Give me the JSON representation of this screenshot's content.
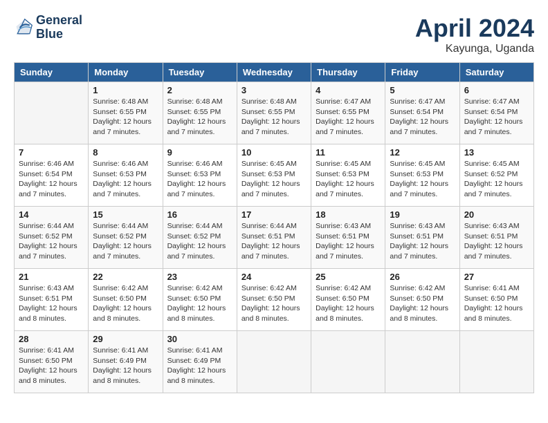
{
  "header": {
    "logo_line1": "General",
    "logo_line2": "Blue",
    "month": "April 2024",
    "location": "Kayunga, Uganda"
  },
  "weekdays": [
    "Sunday",
    "Monday",
    "Tuesday",
    "Wednesday",
    "Thursday",
    "Friday",
    "Saturday"
  ],
  "weeks": [
    [
      {
        "day": "",
        "info": ""
      },
      {
        "day": "1",
        "info": "Sunrise: 6:48 AM\nSunset: 6:55 PM\nDaylight: 12 hours\nand 7 minutes."
      },
      {
        "day": "2",
        "info": "Sunrise: 6:48 AM\nSunset: 6:55 PM\nDaylight: 12 hours\nand 7 minutes."
      },
      {
        "day": "3",
        "info": "Sunrise: 6:48 AM\nSunset: 6:55 PM\nDaylight: 12 hours\nand 7 minutes."
      },
      {
        "day": "4",
        "info": "Sunrise: 6:47 AM\nSunset: 6:55 PM\nDaylight: 12 hours\nand 7 minutes."
      },
      {
        "day": "5",
        "info": "Sunrise: 6:47 AM\nSunset: 6:54 PM\nDaylight: 12 hours\nand 7 minutes."
      },
      {
        "day": "6",
        "info": "Sunrise: 6:47 AM\nSunset: 6:54 PM\nDaylight: 12 hours\nand 7 minutes."
      }
    ],
    [
      {
        "day": "7",
        "info": "Sunrise: 6:46 AM\nSunset: 6:54 PM\nDaylight: 12 hours\nand 7 minutes."
      },
      {
        "day": "8",
        "info": "Sunrise: 6:46 AM\nSunset: 6:53 PM\nDaylight: 12 hours\nand 7 minutes."
      },
      {
        "day": "9",
        "info": "Sunrise: 6:46 AM\nSunset: 6:53 PM\nDaylight: 12 hours\nand 7 minutes."
      },
      {
        "day": "10",
        "info": "Sunrise: 6:45 AM\nSunset: 6:53 PM\nDaylight: 12 hours\nand 7 minutes."
      },
      {
        "day": "11",
        "info": "Sunrise: 6:45 AM\nSunset: 6:53 PM\nDaylight: 12 hours\nand 7 minutes."
      },
      {
        "day": "12",
        "info": "Sunrise: 6:45 AM\nSunset: 6:53 PM\nDaylight: 12 hours\nand 7 minutes."
      },
      {
        "day": "13",
        "info": "Sunrise: 6:45 AM\nSunset: 6:52 PM\nDaylight: 12 hours\nand 7 minutes."
      }
    ],
    [
      {
        "day": "14",
        "info": "Sunrise: 6:44 AM\nSunset: 6:52 PM\nDaylight: 12 hours\nand 7 minutes."
      },
      {
        "day": "15",
        "info": "Sunrise: 6:44 AM\nSunset: 6:52 PM\nDaylight: 12 hours\nand 7 minutes."
      },
      {
        "day": "16",
        "info": "Sunrise: 6:44 AM\nSunset: 6:52 PM\nDaylight: 12 hours\nand 7 minutes."
      },
      {
        "day": "17",
        "info": "Sunrise: 6:44 AM\nSunset: 6:51 PM\nDaylight: 12 hours\nand 7 minutes."
      },
      {
        "day": "18",
        "info": "Sunrise: 6:43 AM\nSunset: 6:51 PM\nDaylight: 12 hours\nand 7 minutes."
      },
      {
        "day": "19",
        "info": "Sunrise: 6:43 AM\nSunset: 6:51 PM\nDaylight: 12 hours\nand 7 minutes."
      },
      {
        "day": "20",
        "info": "Sunrise: 6:43 AM\nSunset: 6:51 PM\nDaylight: 12 hours\nand 7 minutes."
      }
    ],
    [
      {
        "day": "21",
        "info": "Sunrise: 6:43 AM\nSunset: 6:51 PM\nDaylight: 12 hours\nand 8 minutes."
      },
      {
        "day": "22",
        "info": "Sunrise: 6:42 AM\nSunset: 6:50 PM\nDaylight: 12 hours\nand 8 minutes."
      },
      {
        "day": "23",
        "info": "Sunrise: 6:42 AM\nSunset: 6:50 PM\nDaylight: 12 hours\nand 8 minutes."
      },
      {
        "day": "24",
        "info": "Sunrise: 6:42 AM\nSunset: 6:50 PM\nDaylight: 12 hours\nand 8 minutes."
      },
      {
        "day": "25",
        "info": "Sunrise: 6:42 AM\nSunset: 6:50 PM\nDaylight: 12 hours\nand 8 minutes."
      },
      {
        "day": "26",
        "info": "Sunrise: 6:42 AM\nSunset: 6:50 PM\nDaylight: 12 hours\nand 8 minutes."
      },
      {
        "day": "27",
        "info": "Sunrise: 6:41 AM\nSunset: 6:50 PM\nDaylight: 12 hours\nand 8 minutes."
      }
    ],
    [
      {
        "day": "28",
        "info": "Sunrise: 6:41 AM\nSunset: 6:50 PM\nDaylight: 12 hours\nand 8 minutes."
      },
      {
        "day": "29",
        "info": "Sunrise: 6:41 AM\nSunset: 6:49 PM\nDaylight: 12 hours\nand 8 minutes."
      },
      {
        "day": "30",
        "info": "Sunrise: 6:41 AM\nSunset: 6:49 PM\nDaylight: 12 hours\nand 8 minutes."
      },
      {
        "day": "",
        "info": ""
      },
      {
        "day": "",
        "info": ""
      },
      {
        "day": "",
        "info": ""
      },
      {
        "day": "",
        "info": ""
      }
    ]
  ]
}
